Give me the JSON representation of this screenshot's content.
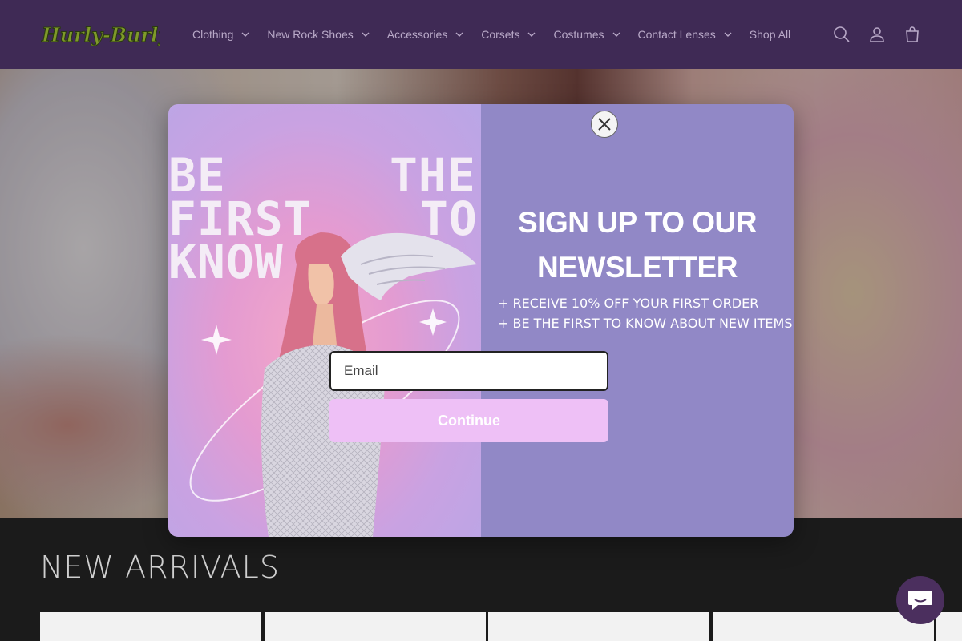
{
  "header": {
    "logo_text": "Hurly-Burly",
    "nav": [
      {
        "label": "Clothing",
        "has_dropdown": true
      },
      {
        "label": "New Rock Shoes",
        "has_dropdown": true
      },
      {
        "label": "Accessories",
        "has_dropdown": true
      },
      {
        "label": "Corsets",
        "has_dropdown": true
      },
      {
        "label": "Costumes",
        "has_dropdown": true
      },
      {
        "label": "Contact Lenses",
        "has_dropdown": true
      },
      {
        "label": "Shop All",
        "has_dropdown": false
      }
    ],
    "icons": [
      "search-icon",
      "account-icon",
      "cart-icon"
    ]
  },
  "popup": {
    "promo_lines": [
      "BE",
      "THE",
      "FIRST",
      "TO",
      "KNOW"
    ],
    "title_line1": "SIGN UP TO OUR",
    "title_line2": "NEWSLETTER",
    "perk1": "+ RECEIVE 10% OFF YOUR FIRST ORDER",
    "perk2": "+ BE THE FIRST TO KNOW ABOUT NEW ITEMS",
    "email_placeholder": "Email",
    "email_value": "",
    "button_label": "Continue",
    "close_icon": "close-icon"
  },
  "section": {
    "title": "NEW ARRIVALS"
  },
  "chat": {
    "icon": "chat-icon"
  },
  "colors": {
    "header_bg": "#3f2a55",
    "popup_panel": "#9188c6",
    "button_bg": "#eec0f6",
    "chat_bg": "#4b2f5e"
  }
}
